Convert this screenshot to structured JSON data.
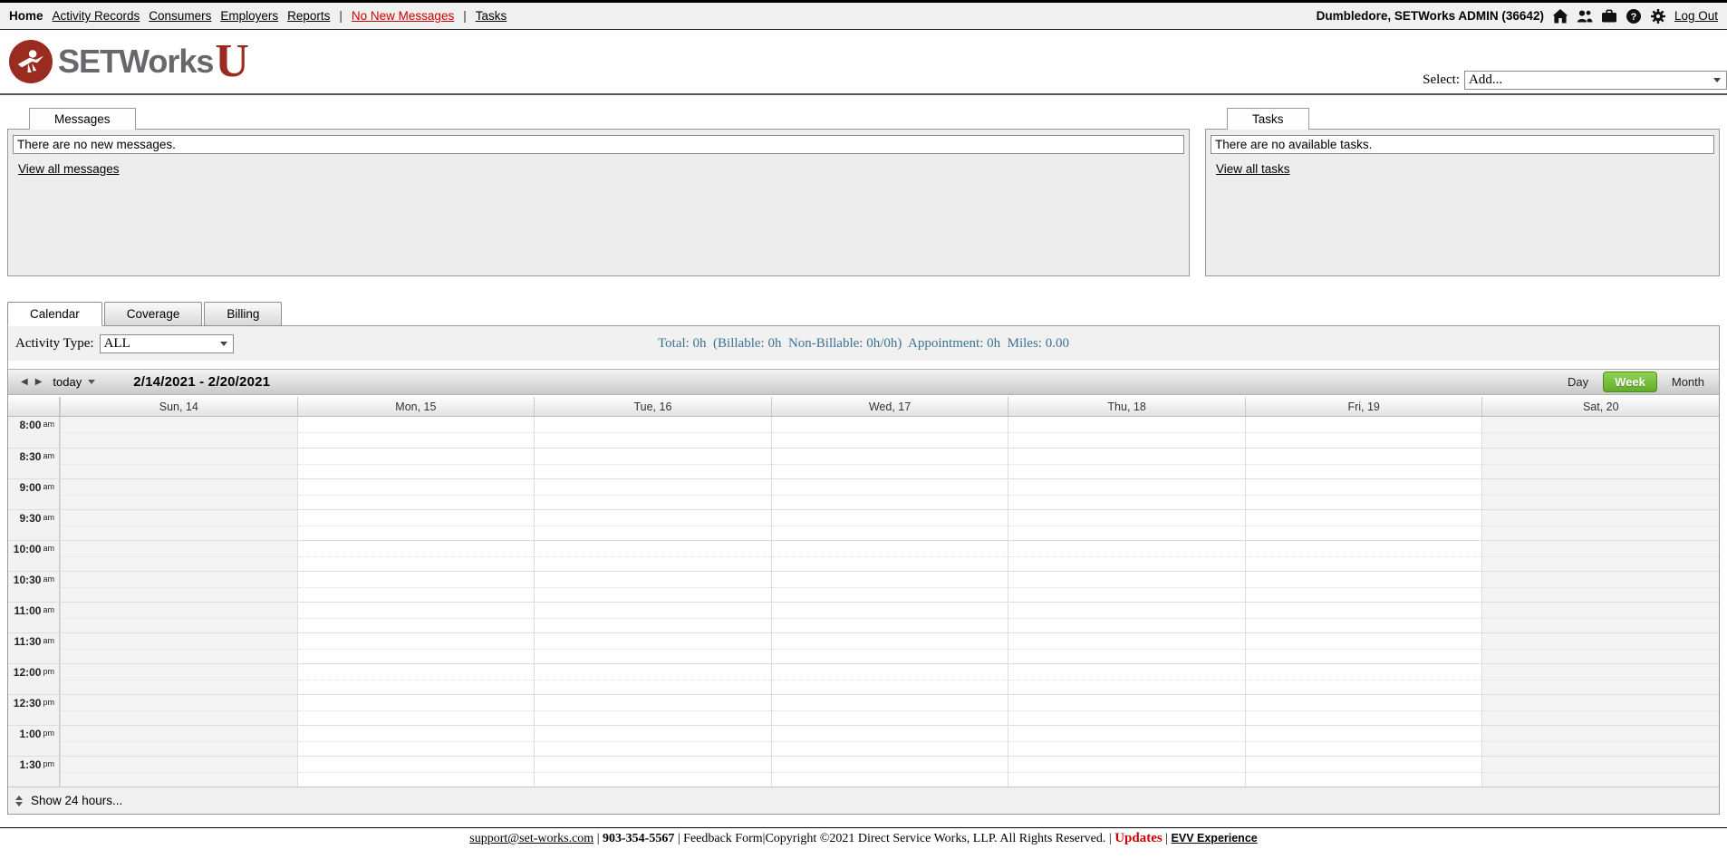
{
  "topnav": {
    "home": "Home",
    "activity_records": "Activity Records",
    "consumers": "Consumers",
    "employers": "Employers",
    "reports": "Reports",
    "divider": "|",
    "no_new_messages": "No New Messages",
    "tasks": "Tasks",
    "user": "Dumbledore, SETWorks ADMIN  (36642)",
    "logout": "Log Out",
    "alert_color": "#cc0000"
  },
  "header": {
    "brand": "SETWorks",
    "brand_suffix": "U",
    "select_label": "Select:",
    "select_value": "Add..."
  },
  "messages_panel": {
    "tab": "Messages",
    "empty": "There are no new messages.",
    "link": "View all messages"
  },
  "tasks_panel": {
    "tab": "Tasks",
    "empty": "There are no available tasks.",
    "link": "View all tasks"
  },
  "main_tabs": [
    {
      "label": "Calendar",
      "active": true
    },
    {
      "label": "Coverage",
      "active": false
    },
    {
      "label": "Billing",
      "active": false
    }
  ],
  "activity": {
    "label": "Activity Type:",
    "value": "ALL",
    "totals": "Total: 0h  (Billable: 0h  Non-Billable: 0h/0h)  Appointment: 0h  Miles: 0.00",
    "totals_color": "#3e7294"
  },
  "calendar": {
    "today_label": "today",
    "range": "2/14/2021 - 2/20/2021",
    "views": [
      "Day",
      "Week",
      "Month"
    ],
    "active_view": "Week",
    "active_view_color": "#63ac29",
    "days": [
      "Sun, 14",
      "Mon, 15",
      "Tue, 16",
      "Wed, 17",
      "Thu, 18",
      "Fri, 19",
      "Sat, 20"
    ],
    "weekend_indices": [
      0,
      6
    ],
    "times": [
      {
        "label": "8:00",
        "meridiem": "am"
      },
      {
        "label": "8:30",
        "meridiem": "am"
      },
      {
        "label": "9:00",
        "meridiem": "am"
      },
      {
        "label": "9:30",
        "meridiem": "am"
      },
      {
        "label": "10:00",
        "meridiem": "am"
      },
      {
        "label": "10:30",
        "meridiem": "am"
      },
      {
        "label": "11:00",
        "meridiem": "am"
      },
      {
        "label": "11:30",
        "meridiem": "am"
      },
      {
        "label": "12:00",
        "meridiem": "pm"
      },
      {
        "label": "12:30",
        "meridiem": "pm"
      },
      {
        "label": "1:00",
        "meridiem": "pm"
      },
      {
        "label": "1:30",
        "meridiem": "pm"
      }
    ],
    "show_24": "Show 24 hours..."
  },
  "footer": {
    "support": "support@set-works.com",
    "sep": " | ",
    "phone": "903-354-5567",
    "feedback": "Feedback Form",
    "pipe": "|",
    "copyright": "Copyright ©2021 Direct Service Works, LLP. All Rights Reserved. ",
    "updates": "Updates",
    "evv": "EVV Experience"
  }
}
